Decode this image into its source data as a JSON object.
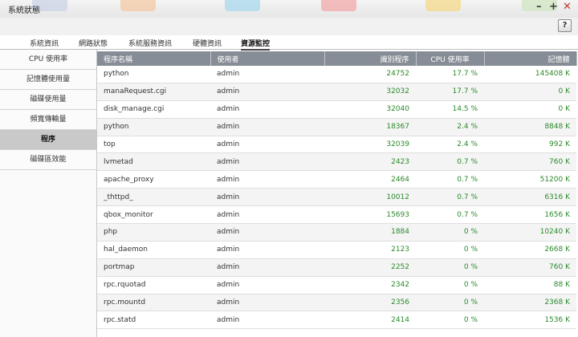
{
  "window": {
    "title": "系統狀態",
    "minimize": "–",
    "maximize": "+",
    "close": "✕",
    "help": "?"
  },
  "tabs": [
    {
      "label": "系統資訊"
    },
    {
      "label": "網路狀態"
    },
    {
      "label": "系統服務資訊"
    },
    {
      "label": "硬體資訊"
    },
    {
      "label": "資源監控",
      "active": true
    }
  ],
  "sidebar": {
    "items": [
      {
        "label": "CPU 使用率"
      },
      {
        "label": "記憶體使用量"
      },
      {
        "label": "磁碟使用量"
      },
      {
        "label": "頻寬傳輸量"
      },
      {
        "label": "程序",
        "active": true
      },
      {
        "label": "磁碟區效能"
      }
    ]
  },
  "table": {
    "headers": [
      "程序名稱",
      "使用者",
      "識別程序",
      "CPU 使用率",
      "記憶體"
    ],
    "rows": [
      [
        "python",
        "admin",
        "24752",
        "17.7 %",
        "145408 K"
      ],
      [
        "manaRequest.cgi",
        "admin",
        "32032",
        "17.7 %",
        "0 K"
      ],
      [
        "disk_manage.cgi",
        "admin",
        "32040",
        "14.5 %",
        "0 K"
      ],
      [
        "python",
        "admin",
        "18367",
        "2.4 %",
        "8848 K"
      ],
      [
        "top",
        "admin",
        "32039",
        "2.4 %",
        "992 K"
      ],
      [
        "lvmetad",
        "admin",
        "2423",
        "0.7 %",
        "760 K"
      ],
      [
        "apache_proxy",
        "admin",
        "2464",
        "0.7 %",
        "51200 K"
      ],
      [
        "_thttpd_",
        "admin",
        "10012",
        "0.7 %",
        "6316 K"
      ],
      [
        "qbox_monitor",
        "admin",
        "15693",
        "0.7 %",
        "1656 K"
      ],
      [
        "php",
        "admin",
        "1884",
        "0 %",
        "10240 K"
      ],
      [
        "hal_daemon",
        "admin",
        "2123",
        "0 %",
        "2668 K"
      ],
      [
        "portmap",
        "admin",
        "2252",
        "0 %",
        "760 K"
      ],
      [
        "rpc.rquotad",
        "admin",
        "2342",
        "0 %",
        "88 K"
      ],
      [
        "rpc.mountd",
        "admin",
        "2356",
        "0 %",
        "2368 K"
      ],
      [
        "rpc.statd",
        "admin",
        "2414",
        "0 %",
        "1536 K"
      ]
    ]
  },
  "colors": {
    "header_bg": "#878d96",
    "numeric_text": "#2b8a2b",
    "active_sidebar": "#c9c9c9"
  },
  "icons": {
    "minimize": "minimize-icon",
    "maximize": "maximize-icon",
    "close": "close-icon",
    "help": "help-icon"
  }
}
